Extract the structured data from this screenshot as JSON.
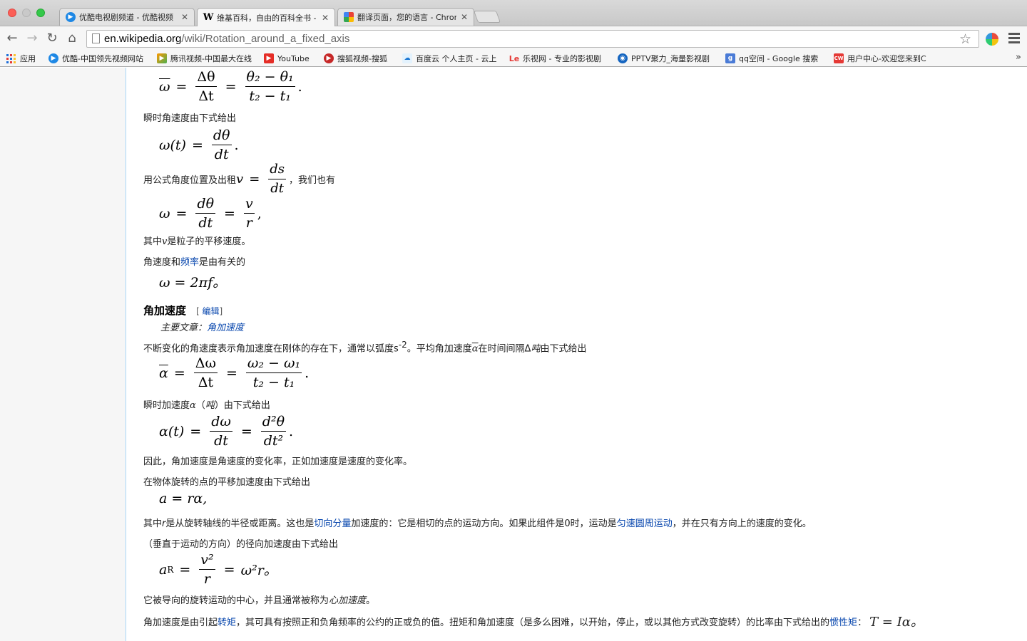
{
  "browser": {
    "tabs": [
      {
        "title": "优酷电视剧频道 - 优酷视频",
        "favicon": "youku-icon",
        "active": false
      },
      {
        "title": "维基百科，自由的百科全书 - ",
        "favicon": "wikipedia-icon",
        "active": true
      },
      {
        "title": "翻译页面，您的语言 - Chrom",
        "favicon": "google-translate-icon",
        "active": false
      }
    ],
    "url_host": "en.wikipedia.org",
    "url_path": "/wiki/Rotation_around_a_fixed_axis",
    "bookmarks": [
      {
        "label": "应用",
        "icon": "apps-icon"
      },
      {
        "label": "优酷-中国领先视频网站",
        "icon": "youku-icon"
      },
      {
        "label": "腾讯视频-中国最大在线",
        "icon": "tencent-video-icon"
      },
      {
        "label": "YouTube",
        "icon": "youtube-icon"
      },
      {
        "label": "搜狐视频-搜狐",
        "icon": "sohu-icon"
      },
      {
        "label": "百度云 个人主页 - 云上",
        "icon": "baidu-cloud-icon"
      },
      {
        "label": "乐视网 - 专业的影视剧",
        "icon": "letv-icon"
      },
      {
        "label": "PPTV聚力_海量影视剧",
        "icon": "pptv-icon"
      },
      {
        "label": "qq空间 - Google 搜索",
        "icon": "google-icon"
      },
      {
        "label": "用户中心-欢迎您来到C",
        "icon": "cw-icon"
      }
    ],
    "bookmarks_more": "»"
  },
  "article": {
    "eq_avg_omega": {
      "lhs": "ω",
      "dnum": "Δθ",
      "dden": "Δt",
      "num": "θ₂ − θ₁",
      "den": "t₂ − t₁",
      "end": "."
    },
    "instant_omega_text": "瞬时角速度由下式给出",
    "eq_omega_t": {
      "lhs": "ω(t)",
      "num": "dθ",
      "den": "dt",
      "end": "."
    },
    "formula_text_pre": "用公式角度位置及出租",
    "formula_v": {
      "lhs": "v",
      "num": "ds",
      "den": "dt"
    },
    "formula_text_post": "，我们也有",
    "eq_omega_v": {
      "lhs": "ω",
      "num1": "dθ",
      "den1": "dt",
      "num2": "v",
      "den2": "r",
      "end": ","
    },
    "v_text_pre": "其中",
    "v_symbol": "v",
    "v_text_post": "是粒子的平移速度。",
    "freq_text_pre": "角速度和",
    "freq_link": "频率",
    "freq_text_post": "是由有关的",
    "eq_omega_f": "ω = 2πf。",
    "heading": "角加速度",
    "edit_open": "[ ",
    "edit_link": "编辑",
    "edit_close": "]",
    "hatnote_pre": "主要文章：",
    "hatnote_link": "角加速度",
    "accel_text_1": "不断变化的角速度表示角加速度在刚体的存在下，通常以弧度s",
    "accel_sup": "-2",
    "accel_text_2": "。平均角加速度",
    "accel_alpha": "α",
    "accel_text_3": "在时间间隔Δ",
    "accel_t": "吨",
    "accel_text_4": "由下式给出",
    "eq_avg_alpha": {
      "lhs": "α",
      "dnum": "Δω",
      "dden": "Δt",
      "num": "ω₂ − ω₁",
      "den": "t₂ − t₁",
      "end": "."
    },
    "instant_alpha_pre": "瞬时加速度",
    "instant_alpha_sym": "α",
    "instant_alpha_paren": "（",
    "instant_alpha_t": "吨",
    "instant_alpha_post": "）由下式给出",
    "eq_alpha_t": {
      "lhs": "α(t)",
      "num1": "dω",
      "den1": "dt",
      "num2": "d²θ",
      "den2": "dt²",
      "end": "."
    },
    "therefore_text": "因此，角加速度是角速度的变化率，正如加速度是速度的变化率。",
    "tangential_text": "在物体旋转的点的平移加速度由下式给出",
    "eq_a": "a = rα,",
    "r_text_pre": "其中",
    "r_symbol": "r",
    "r_text_mid": "是从旋转轴线的半径或距离。这也是",
    "r_link_1": "切向分量",
    "r_text_mid2": "加速度的：它是相切的点的运动方向。如果此组件是0时，运动是",
    "r_link_2": "匀速圆周运动",
    "r_text_post": "，并在只有方向上的速度的变化。",
    "radial_text": "（垂直于运动的方向）的径向加速度由下式给出",
    "eq_ar": {
      "lhs": "a",
      "sub": "R",
      "num": "v²",
      "den": "r",
      "rhs": "ω²r。"
    },
    "centripetal_pre": "它被导向的旋转运动的中心，并且通常被称为",
    "centripetal_em": "心加速度",
    "centripetal_post": "。",
    "torque_pre": "角加速度是由引起",
    "torque_link": "转矩",
    "torque_mid": "，其可具有按照正和负角频率的公约的正或负的值。扭矩和角加速度（是多么困难，以开始，停止，或以其他方式改变旋转）的比率由下式给出的",
    "torque_link2": "惯性矩",
    "torque_colon": "：",
    "torque_eq": "T = Iα。"
  }
}
